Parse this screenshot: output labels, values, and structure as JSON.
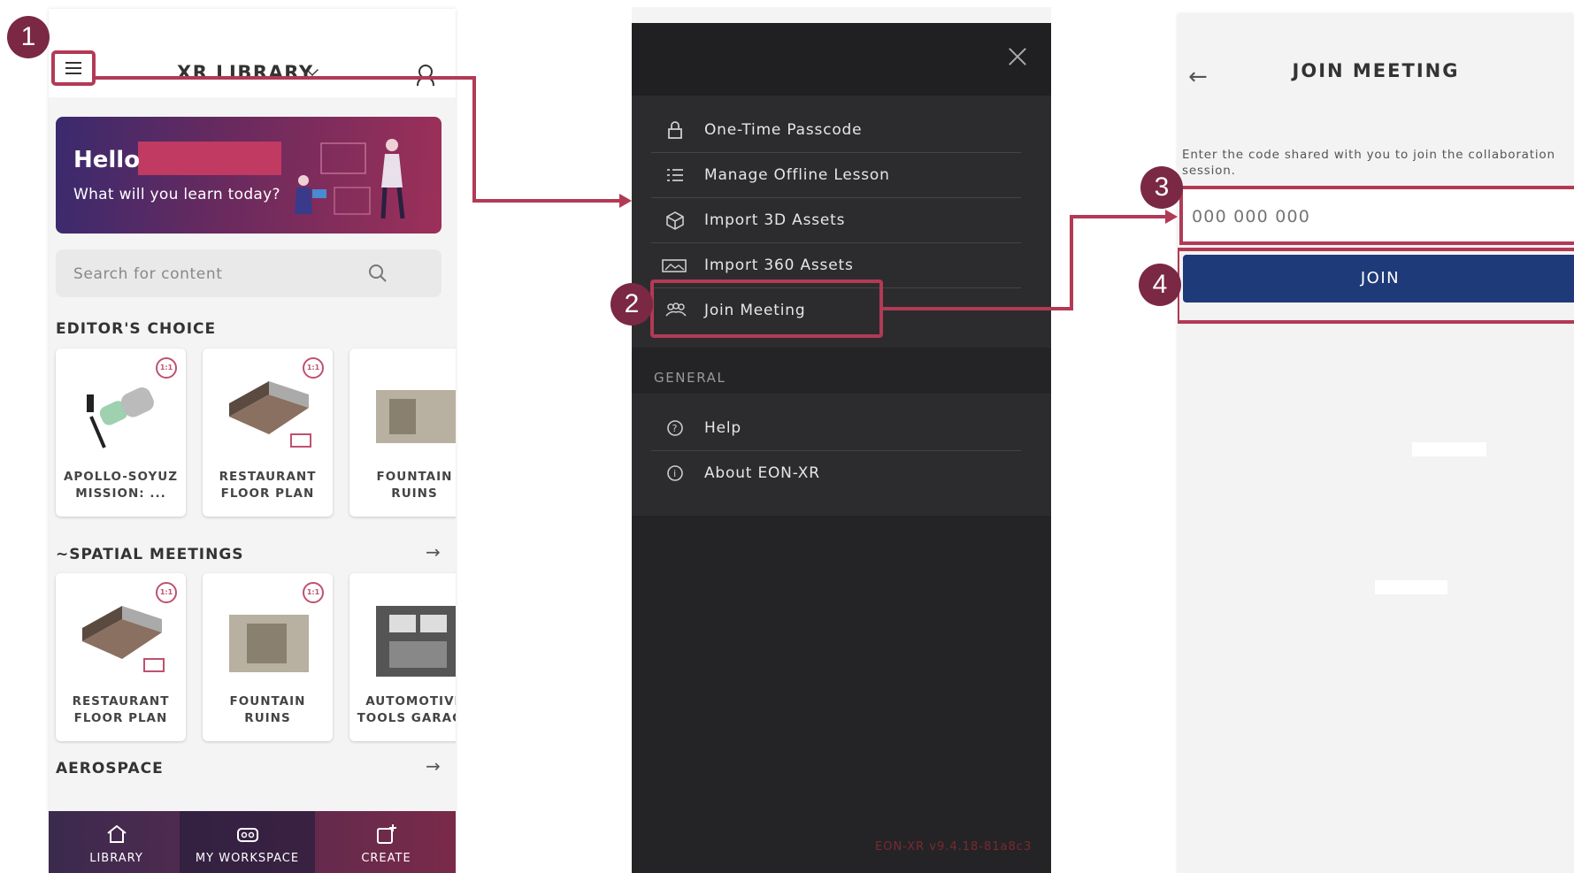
{
  "colors": {
    "accent": "#b23a55",
    "step_badge": "#7a2844",
    "join_button": "#1e3a78",
    "menu_bg": "#242426"
  },
  "steps": [
    "1",
    "2",
    "3",
    "4"
  ],
  "library": {
    "title": "XR LIBRARY",
    "banner": {
      "greeting": "Hello",
      "subtitle": "What will you learn today?"
    },
    "search": {
      "placeholder": "Search for content"
    },
    "sections": [
      {
        "title": "EDITOR'S CHOICE",
        "cards": [
          {
            "title1": "APOLLO-SOYUZ",
            "title2": "MISSION: ...",
            "badge": "1:1"
          },
          {
            "title1": "RESTAURANT",
            "title2": "FLOOR PLAN",
            "badge": "1:1"
          },
          {
            "title1": "FOUNTAIN",
            "title2": "RUINS"
          }
        ]
      },
      {
        "title": "~SPATIAL MEETINGS",
        "cards": [
          {
            "title1": "RESTAURANT",
            "title2": "FLOOR PLAN",
            "badge": "1:1"
          },
          {
            "title1": "FOUNTAIN",
            "title2": "RUINS",
            "badge": "1:1"
          },
          {
            "title1": "AUTOMOTIVE",
            "title2": "TOOLS GARAGE"
          }
        ]
      },
      {
        "title": "AEROSPACE"
      }
    ],
    "nav": [
      {
        "label": "LIBRARY",
        "icon": "home-icon"
      },
      {
        "label": "MY WORKSPACE",
        "icon": "headset-icon"
      },
      {
        "label": "CREATE",
        "icon": "create-icon"
      }
    ]
  },
  "menu": {
    "items": [
      {
        "label": "One-Time Passcode",
        "icon": "lock-icon"
      },
      {
        "label": "Manage Offline Lesson",
        "icon": "list-icon"
      },
      {
        "label": "Import 3D Assets",
        "icon": "cube-icon"
      },
      {
        "label": "Import 360 Assets",
        "icon": "panorama-icon"
      },
      {
        "label": "Join Meeting",
        "icon": "people-icon"
      }
    ],
    "general_label": "GENERAL",
    "general_items": [
      {
        "label": "Help",
        "icon": "help-icon"
      },
      {
        "label": "About EON-XR",
        "icon": "info-icon"
      }
    ],
    "version": "EON-XR v9.4.18-81a8c3"
  },
  "join": {
    "title": "JOIN MEETING",
    "description": "Enter the code shared with you to join the collaboration session.",
    "code_placeholder": "000 000 000",
    "button": "JOIN"
  }
}
